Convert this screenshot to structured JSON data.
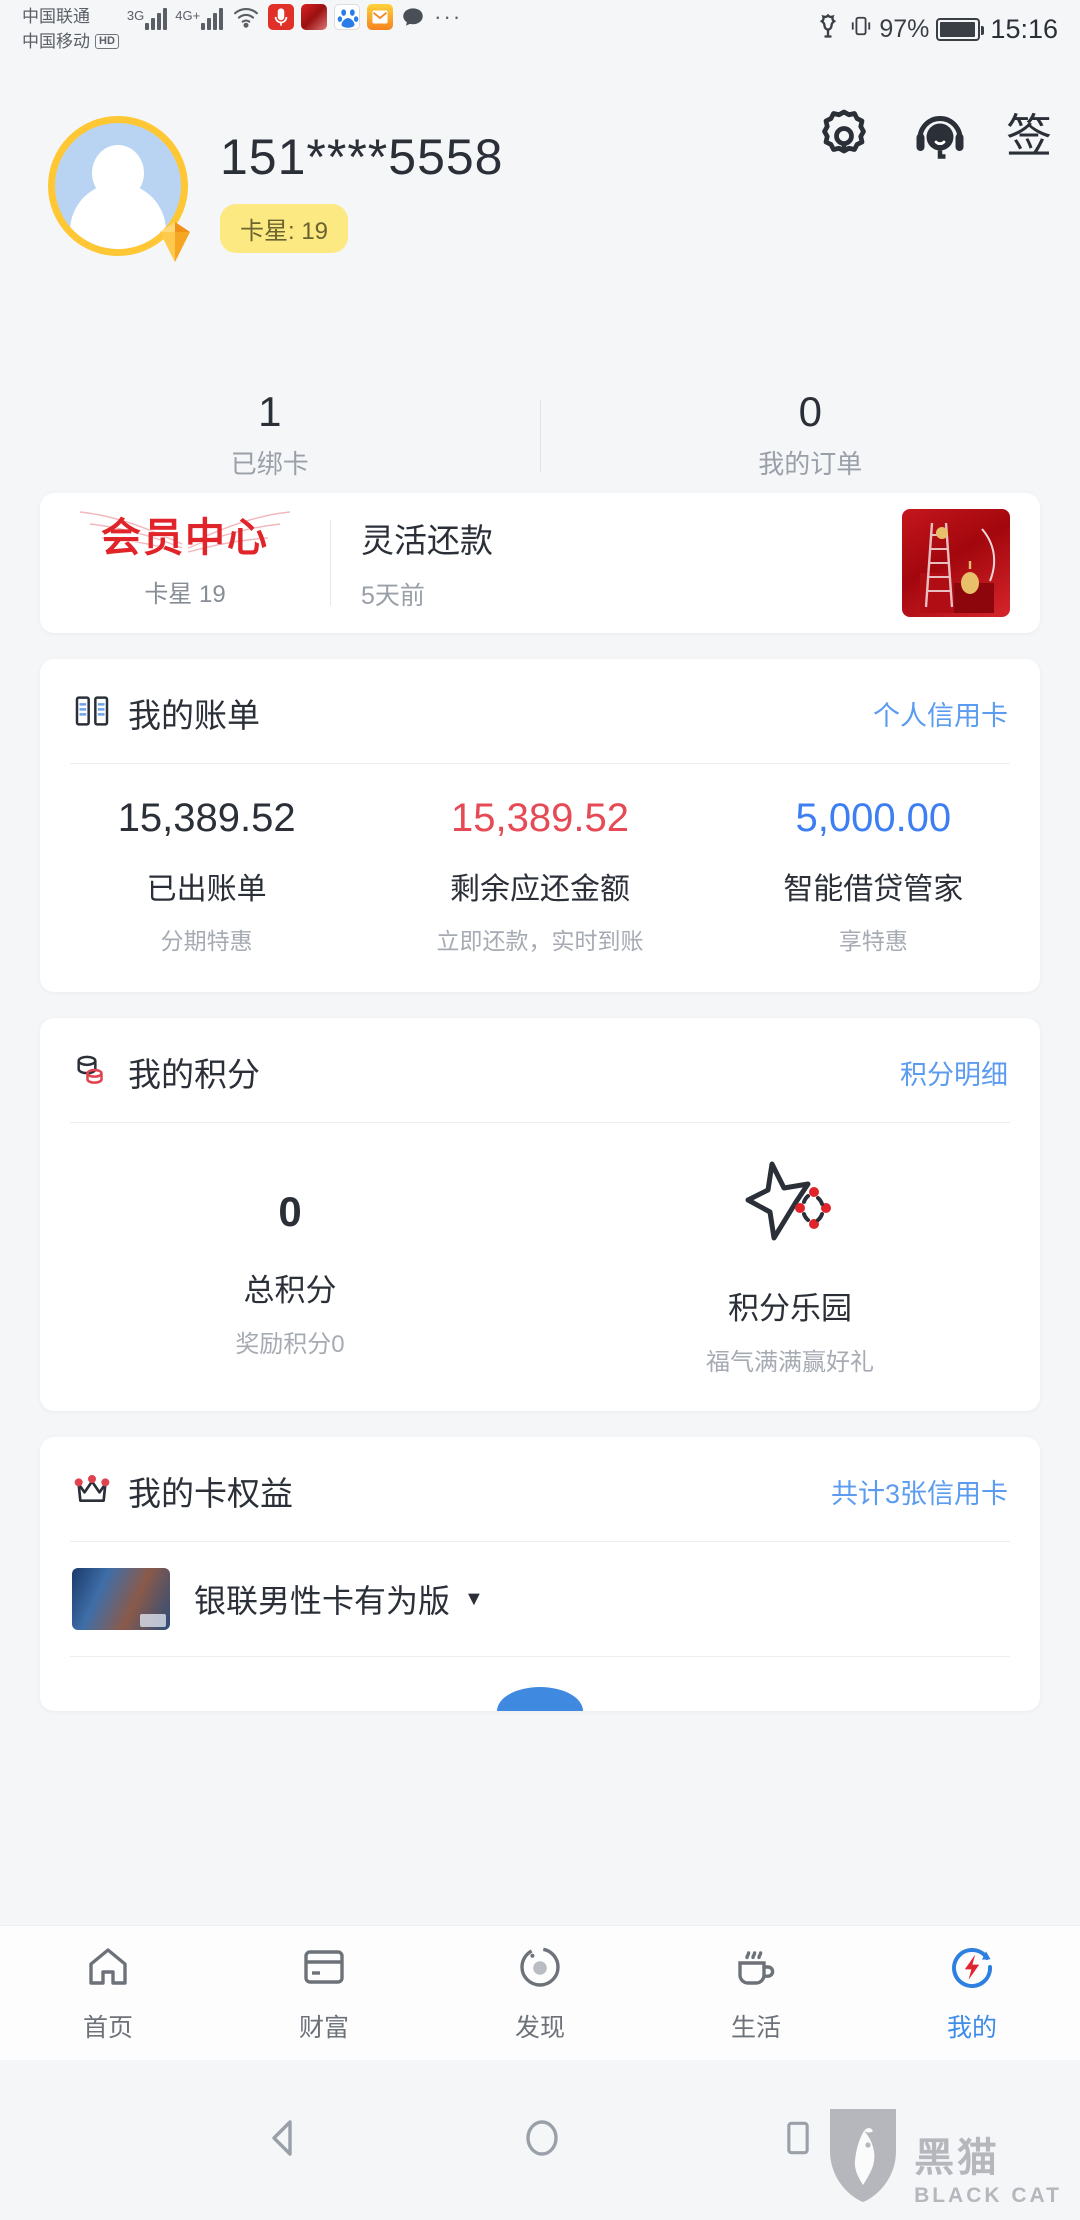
{
  "status_bar": {
    "carrier_primary": "中国联通",
    "carrier_secondary": "中国移动",
    "hd_badge": "HD",
    "network_1": "3G",
    "network_2": "4G+",
    "battery_percent": "97%",
    "time": "15:16"
  },
  "header": {
    "settings_icon": "gear-icon",
    "service_icon": "headset-customer-service-icon",
    "sign_in_label": "签",
    "phone_number": "151****5558",
    "star_badge": "卡星: 19"
  },
  "stats": [
    {
      "value": "1",
      "label": "已绑卡"
    },
    {
      "value": "0",
      "label": "我的订单"
    }
  ],
  "member_card": {
    "vip_title": "会员中心",
    "vip_sub": "卡星 19",
    "promo_title": "灵活还款",
    "promo_time": "5天前"
  },
  "bill_card": {
    "icon": "bill-book-icon",
    "title": "我的账单",
    "link": "个人信用卡",
    "items": [
      {
        "amount": "15,389.52",
        "name": "已出账单",
        "sub": "分期特惠",
        "color": "#2b3038"
      },
      {
        "amount": "15,389.52",
        "name": "剩余应还金额",
        "sub": "立即还款，实时到账",
        "color": "#e54a55"
      },
      {
        "amount": "5,000.00",
        "name": "智能借贷管家",
        "sub": "享特惠",
        "color": "#3d7ff2"
      }
    ]
  },
  "points_card": {
    "icon": "coins-stack-icon",
    "title": "我的积分",
    "link": "积分明细",
    "total_value": "0",
    "total_label": "总积分",
    "total_sub": "奖励积分0",
    "park_icon": "star-points-park-icon",
    "park_label": "积分乐园",
    "park_sub": "福气满满赢好礼"
  },
  "rights_card": {
    "icon": "crown-icon",
    "title": "我的卡权益",
    "link": "共计3张信用卡",
    "card_name": "银联男性卡有为版",
    "caret": "▼"
  },
  "tabbar": [
    {
      "icon": "home-icon",
      "label": "首页",
      "active": false
    },
    {
      "icon": "credit-card-icon",
      "label": "财富",
      "active": false
    },
    {
      "icon": "discover-compass-icon",
      "label": "发现",
      "active": false
    },
    {
      "icon": "coffee-cup-icon",
      "label": "生活",
      "active": false
    },
    {
      "icon": "lightning-circle-icon",
      "label": "我的",
      "active": true
    }
  ],
  "system_nav": {
    "back_icon": "back-triangle-icon",
    "home_icon": "home-circle-icon",
    "recents_icon": "recents-square-icon"
  },
  "watermark": {
    "cn": "黑猫",
    "en": "BLACK CAT"
  },
  "colors": {
    "accent_blue": "#3d8ce8",
    "red": "#e54a55",
    "gold": "#ffc734",
    "link_blue": "#5b9bf0"
  }
}
